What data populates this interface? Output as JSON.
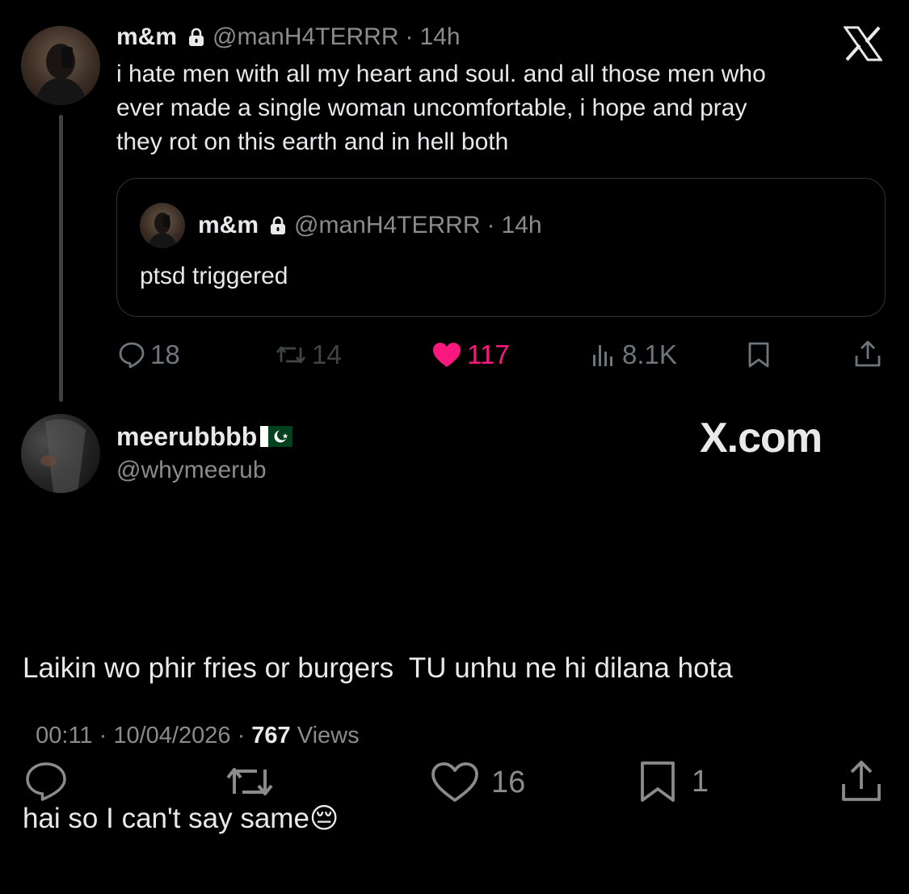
{
  "parent_tweet": {
    "display_name": "m&m",
    "handle": "@manH4TERRR",
    "time": "14h",
    "separator": "·",
    "text_lines": [
      "i hate men with all my heart and soul. and all those men who",
      "ever made a single woman uncomfortable, i hope and pray",
      "they rot on this earth and in hell both"
    ],
    "quoted": {
      "display_name": "m&m",
      "handle": "@manH4TERRR",
      "time": "14h",
      "text": "ptsd triggered"
    },
    "actions": {
      "replies": "18",
      "reposts": "14",
      "likes": "117",
      "views": "8.1K"
    }
  },
  "reply_tweet": {
    "display_name": "meerubbbb",
    "flag_icon": "pakistan-flag-icon",
    "handle": "@whymeerub",
    "text_line1": "Laikin wo phir fries or burgers  TU unhu ne hi dilana hota",
    "text_line2": "hai so I can't say same",
    "emoji": "😔",
    "meta": {
      "time": "00:11",
      "date": "10/04/2026",
      "sep": "·",
      "views_count": "767",
      "views_label": "Views"
    },
    "actions": {
      "likes": "16",
      "bookmarks": "1"
    }
  },
  "branding": {
    "logo_icon": "x-logo-icon",
    "watermark": "X.com"
  },
  "colors": {
    "background": "#000000",
    "text": "#e7e9ea",
    "muted": "#8b8b8b",
    "like_pink": "#f91880",
    "thread_line": "#3e4144"
  }
}
